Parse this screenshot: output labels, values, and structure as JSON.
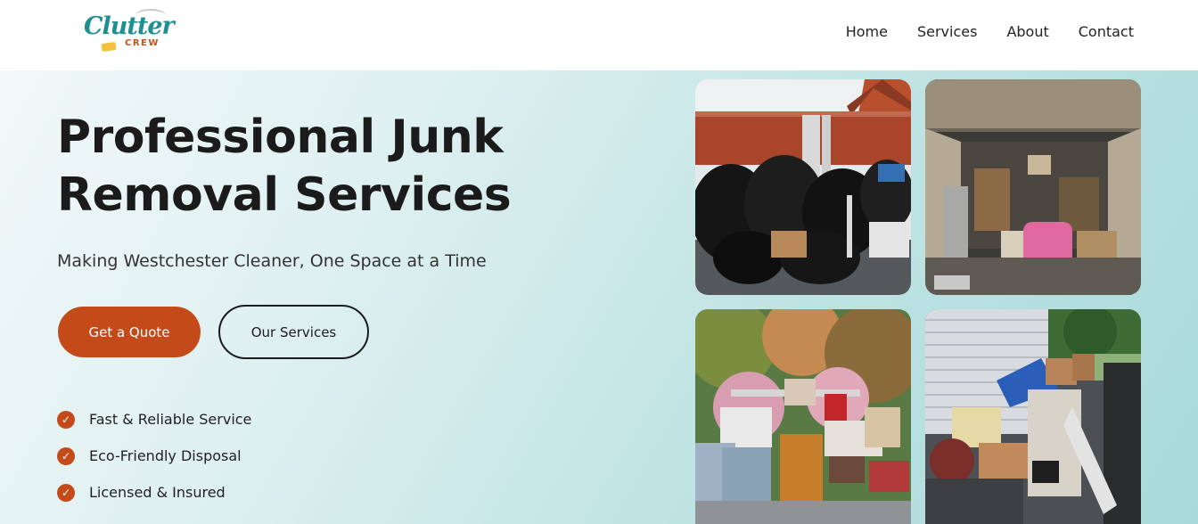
{
  "brand": {
    "logo_main": "Clutter",
    "logo_sub": "CREW"
  },
  "nav": {
    "items": [
      {
        "label": "Home"
      },
      {
        "label": "Services"
      },
      {
        "label": "About"
      },
      {
        "label": "Contact"
      }
    ]
  },
  "hero": {
    "title_line1": "Professional Junk",
    "title_line2": "Removal Services",
    "subtitle": "Making Westchester Cleaner, One Space at a Time",
    "primary_button": "Get a Quote",
    "secondary_button": "Our Services",
    "features": [
      {
        "label": "Fast & Reliable Service"
      },
      {
        "label": "Eco-Friendly Disposal"
      },
      {
        "label": "Licensed & Insured"
      }
    ]
  },
  "colors": {
    "accent": "#c44a1a",
    "brand_teal": "#1f8f8f",
    "hero_gradient_end": "#a9dada"
  },
  "icons": {
    "feature_check": "check-circle-icon"
  }
}
